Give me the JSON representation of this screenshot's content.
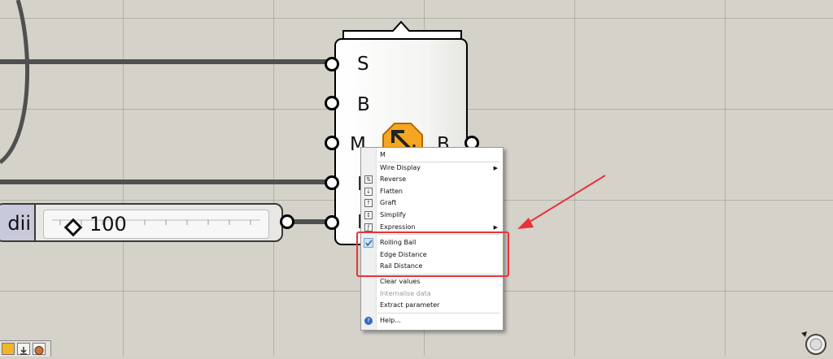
{
  "component": {
    "inputs": [
      "S",
      "B",
      "M",
      "E",
      "R"
    ],
    "output": "B",
    "icon": "fillet-edge-icon"
  },
  "slider": {
    "label": "dii",
    "value": "100"
  },
  "context_menu": {
    "title": "M",
    "items": [
      {
        "label": "Wire Display",
        "submenu": true,
        "icon": "",
        "enabled": true
      },
      {
        "label": "Reverse",
        "icon": "reverse-icon",
        "enabled": true
      },
      {
        "label": "Flatten",
        "icon": "flatten-icon",
        "enabled": true
      },
      {
        "label": "Graft",
        "icon": "graft-icon",
        "enabled": true
      },
      {
        "label": "Simplify",
        "icon": "simplify-icon",
        "enabled": true
      },
      {
        "label": "Expression",
        "submenu": true,
        "icon": "expression-icon",
        "enabled": true
      },
      {
        "label": "Rolling Ball",
        "checked": true,
        "enabled": true
      },
      {
        "label": "Edge Distance",
        "enabled": true
      },
      {
        "label": "Rail Distance",
        "enabled": true
      },
      {
        "label": "Clear values",
        "enabled": true
      },
      {
        "label": "Internalise data",
        "enabled": false
      },
      {
        "label": "Extract parameter",
        "enabled": true
      },
      {
        "label": "Help...",
        "icon": "help-icon",
        "enabled": true
      }
    ]
  },
  "colors": {
    "canvas": "#d5d2ca",
    "highlight": "#e8323a",
    "icon_orange": "#f5a623",
    "slider_label_bg": "#c8cadb"
  }
}
